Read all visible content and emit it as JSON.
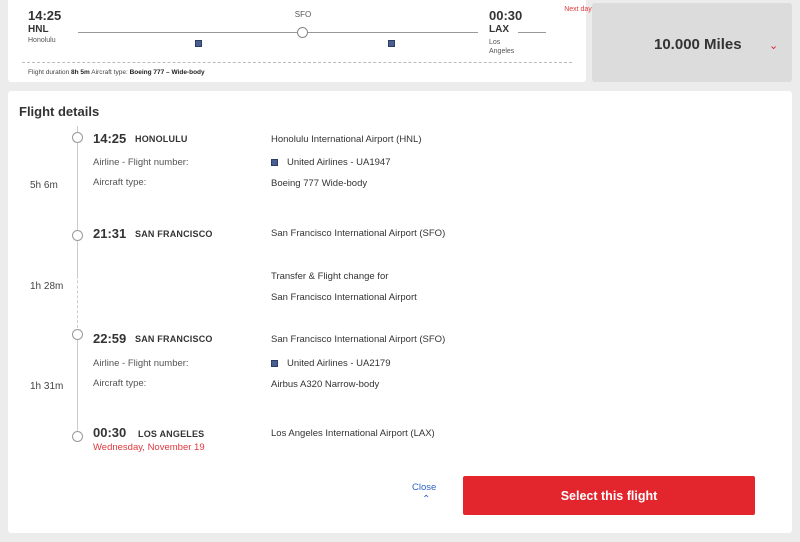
{
  "summary": {
    "departure": {
      "time": "14:25",
      "code": "HNL",
      "city": "Honolulu"
    },
    "stop": {
      "code": "SFO"
    },
    "arrival": {
      "time": "00:30",
      "code": "LAX",
      "city": "Los Angeles"
    },
    "next_day_label": "Next day",
    "meta": {
      "duration_label": "Flight duration",
      "duration_value": "8h 5m",
      "aircraft_label": "Aircraft type:",
      "aircraft_value": "Boeing 777 – Wide-body"
    },
    "airline_icon": "airline-logo-icon"
  },
  "price": {
    "text": "10.000 Miles",
    "chevron": "⌄"
  },
  "details": {
    "title": "Flight details",
    "segments": [
      {
        "duration": "5h 6m",
        "dep_time": "14:25",
        "dep_city": "HONOLULU",
        "dep_airport": "Honolulu International Airport (HNL)",
        "airline_label": "Airline - Flight number:",
        "airline_value": "United Airlines - UA1947",
        "aircraft_label": "Aircraft type:",
        "aircraft_value": "Boeing 777 Wide-body"
      },
      {
        "duration": "1h 31m",
        "dep_time": "22:59",
        "dep_city": "SAN FRANCISCO",
        "dep_airport": "San Francisco International Airport (SFO)",
        "airline_label": "Airline - Flight number:",
        "airline_value": "United Airlines - UA2179",
        "aircraft_label": "Aircraft type:",
        "aircraft_value": "Airbus A320 Narrow-body"
      }
    ],
    "stopover": {
      "arr_time": "21:31",
      "arr_city": "SAN FRANCISCO",
      "arr_airport": "San Francisco International Airport (SFO)",
      "duration": "1h 28m",
      "transfer_line1": "Transfer & Flight change for",
      "transfer_line2": "San Francisco International Airport"
    },
    "final": {
      "arr_time": "00:30",
      "arr_city": "LOS ANGELES",
      "arr_date": "Wednesday, November 19",
      "arr_airport": "Los Angeles International Airport (LAX)"
    }
  },
  "actions": {
    "close_label": "Close",
    "close_chevron": "⌃",
    "select_label": "Select this flight"
  },
  "colors": {
    "accent": "#e3262e",
    "link": "#2e63c9",
    "date_red": "#e0393e"
  }
}
